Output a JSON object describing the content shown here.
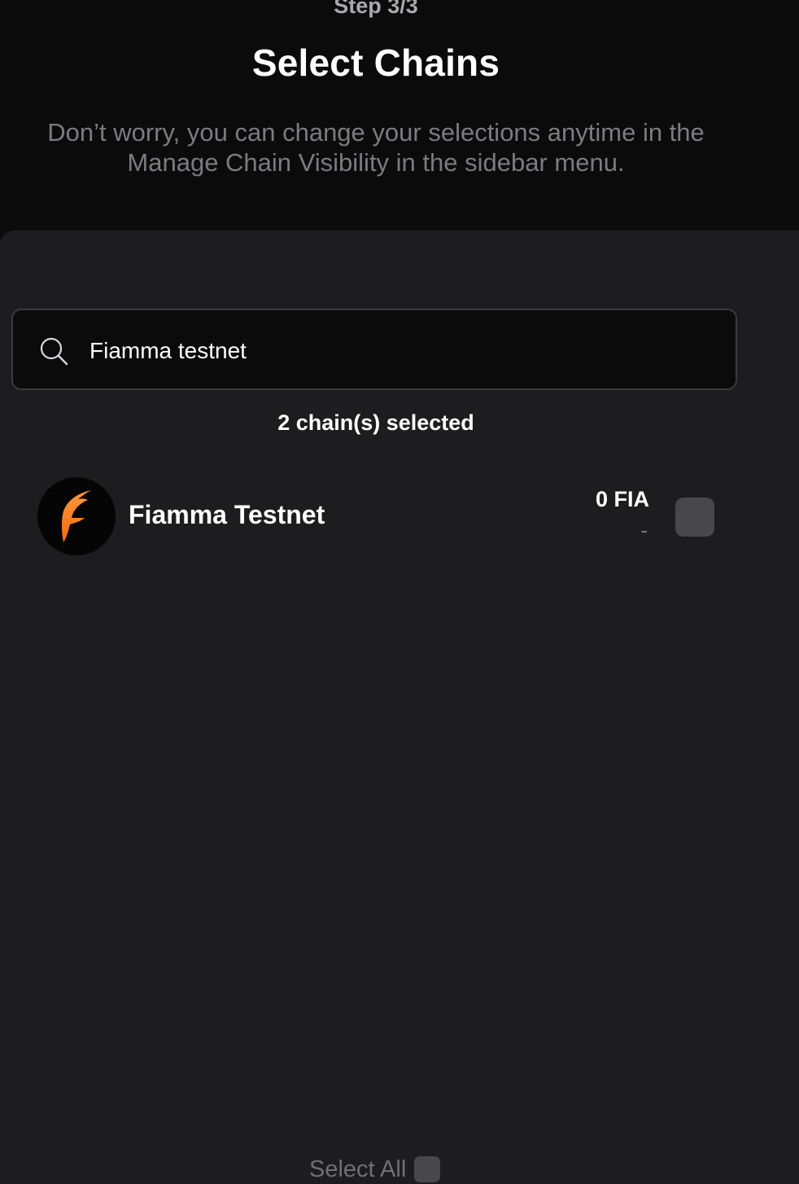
{
  "header": {
    "step": "Step 3/3",
    "title": "Select Chains",
    "subtitle": "Don’t worry, you can change your selections anytime in the Manage Chain Visibility in the sidebar menu."
  },
  "search": {
    "value": "Fiamma testnet",
    "icon": "search-icon"
  },
  "selection": {
    "count_text": "2 chain(s) selected"
  },
  "chains": [
    {
      "name": "Fiamma Testnet",
      "balance": "0 FIA",
      "fiat": "-",
      "icon": "fiamma-logo-icon",
      "checked": false
    }
  ],
  "footer": {
    "select_all_label": "Select All"
  },
  "colors": {
    "background": "#0b0b0c",
    "panel": "#1d1d1f",
    "checkbox": "#48484c",
    "accent": "#f47b20"
  }
}
